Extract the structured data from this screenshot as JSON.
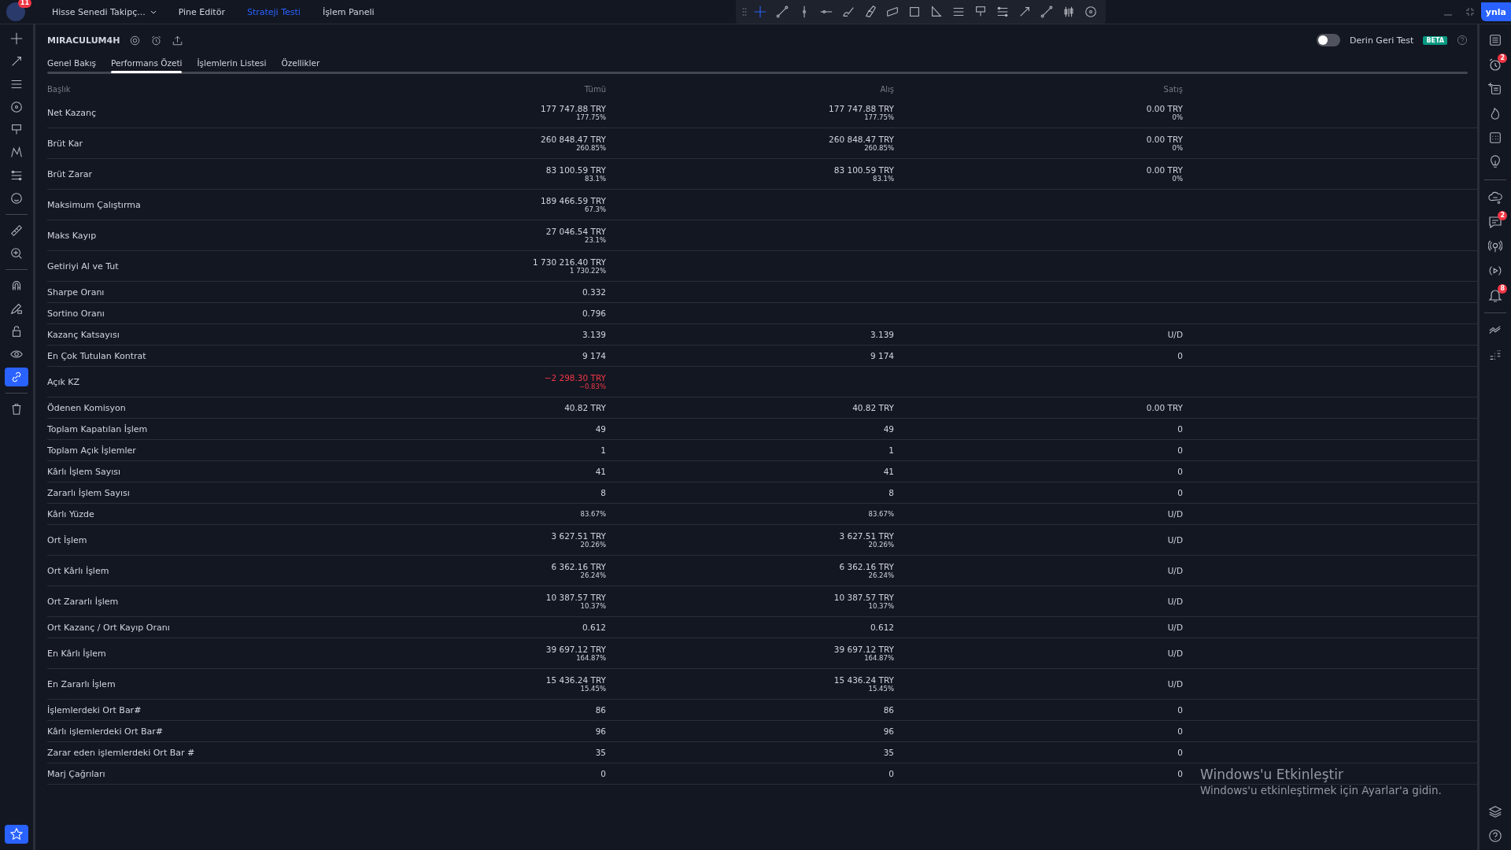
{
  "topbar": {
    "logo_badge": "11",
    "menu": [
      {
        "label": "Hisse Senedi Takipç...",
        "dropdown": true,
        "selected": false
      },
      {
        "label": "Pine Editör",
        "dropdown": false,
        "selected": false
      },
      {
        "label": "Strateji Testi",
        "dropdown": false,
        "selected": true
      },
      {
        "label": "İşlem Paneli",
        "dropdown": false,
        "selected": false
      }
    ],
    "drawing_tools": [
      {
        "kind": "cross",
        "selected": true
      },
      {
        "kind": "trend",
        "selected": false
      },
      {
        "kind": "vline",
        "selected": false
      },
      {
        "kind": "hline",
        "selected": false
      },
      {
        "kind": "brush",
        "selected": false
      },
      {
        "kind": "highlighter",
        "selected": false
      },
      {
        "kind": "parallel",
        "selected": false
      },
      {
        "kind": "rect",
        "selected": false
      },
      {
        "kind": "triangle",
        "selected": false
      },
      {
        "kind": "lines",
        "selected": false
      },
      {
        "kind": "flag",
        "selected": false
      },
      {
        "kind": "fib",
        "selected": false
      },
      {
        "kind": "arrow",
        "selected": false
      },
      {
        "kind": "trend",
        "selected": false
      },
      {
        "kind": "candles",
        "selected": false
      },
      {
        "kind": "circle",
        "selected": false
      }
    ],
    "publish_button": "ynla"
  },
  "left_toolbar": [
    {
      "kind": "cross",
      "selected": false
    },
    {
      "kind": "arrow",
      "selected": false
    },
    {
      "kind": "lines",
      "selected": false
    },
    {
      "kind": "circle",
      "selected": false
    },
    {
      "kind": "flag",
      "selected": false
    },
    {
      "kind": "pattern",
      "selected": false
    },
    {
      "kind": "fib",
      "selected": false
    },
    {
      "kind": "smile",
      "selected": false
    },
    {
      "kind": "ruler",
      "selected": false
    },
    {
      "kind": "zoom",
      "selected": false
    },
    {
      "kind": "magnet",
      "selected": false
    },
    {
      "kind": "pencil",
      "selected": false
    },
    {
      "kind": "lock",
      "selected": false
    },
    {
      "kind": "eye",
      "selected": false
    },
    {
      "kind": "link",
      "selected": true
    },
    {
      "kind": "trash",
      "selected": false
    }
  ],
  "left_bottom": {
    "kind": "star",
    "selected": true
  },
  "right_toolbar": [
    {
      "kind": "list"
    },
    {
      "kind": "alarm",
      "badge": "2"
    },
    {
      "kind": "addlist"
    },
    {
      "kind": "fire"
    },
    {
      "kind": "calendar"
    },
    {
      "kind": "bulb"
    },
    {
      "kind": "cloud"
    },
    {
      "kind": "chat",
      "badge": "2"
    },
    {
      "kind": "broadcast"
    },
    {
      "kind": "play"
    },
    {
      "kind": "bell",
      "badge": "8"
    },
    {
      "kind": "wave"
    },
    {
      "kind": "dots"
    }
  ],
  "right_bottom": [
    {
      "kind": "layers"
    },
    {
      "kind": "help"
    }
  ],
  "strategy": {
    "name": "MIRACULUM4H",
    "deep_backtest": {
      "label": "Derin Geri Test",
      "on": false,
      "badge": "BETA"
    }
  },
  "tabs": [
    {
      "label": "Genel Bakış",
      "selected": false
    },
    {
      "label": "Performans Özeti",
      "selected": true
    },
    {
      "label": "İşlemlerin Listesi",
      "selected": false
    },
    {
      "label": "Özellikler",
      "selected": false
    }
  ],
  "table": {
    "columns": [
      "Başlık",
      "Tümü",
      "Alış",
      "Satış"
    ],
    "rows": [
      {
        "label": "Net Kazanç",
        "negative": false,
        "values": [
          {
            "value": "177 747.88 TRY",
            "sub": "177.75%"
          },
          {
            "value": "177 747.88 TRY",
            "sub": "177.75%"
          },
          {
            "value": "0.00 TRY",
            "sub": "0%"
          }
        ]
      },
      {
        "label": "Brüt Kar",
        "negative": false,
        "values": [
          {
            "value": "260 848.47 TRY",
            "sub": "260.85%"
          },
          {
            "value": "260 848.47 TRY",
            "sub": "260.85%"
          },
          {
            "value": "0.00 TRY",
            "sub": "0%"
          }
        ]
      },
      {
        "label": "Brüt Zarar",
        "negative": false,
        "values": [
          {
            "value": "83 100.59 TRY",
            "sub": "83.1%"
          },
          {
            "value": "83 100.59 TRY",
            "sub": "83.1%"
          },
          {
            "value": "0.00 TRY",
            "sub": "0%"
          }
        ]
      },
      {
        "label": "Maksimum Çalıştırma",
        "negative": false,
        "values": [
          {
            "value": "189 466.59 TRY",
            "sub": "67.3%"
          }
        ]
      },
      {
        "label": "Maks Kayıp",
        "negative": false,
        "values": [
          {
            "value": "27 046.54 TRY",
            "sub": "23.1%"
          }
        ]
      },
      {
        "label": "Getiriyi Al ve Tut",
        "negative": false,
        "values": [
          {
            "value": "1 730 216.40 TRY",
            "sub": "1 730.22%"
          }
        ]
      },
      {
        "label": "Sharpe Oranı",
        "negative": false,
        "values": [
          {
            "value": "0.332"
          }
        ]
      },
      {
        "label": "Sortino Oranı",
        "negative": false,
        "values": [
          {
            "value": "0.796"
          }
        ]
      },
      {
        "label": "Kazanç Katsayısı",
        "negative": false,
        "values": [
          {
            "value": "3.139"
          },
          {
            "value": "3.139"
          },
          {
            "value": "U/D"
          }
        ]
      },
      {
        "label": "En Çok Tutulan Kontrat",
        "negative": false,
        "values": [
          {
            "value": "9 174"
          },
          {
            "value": "9 174"
          },
          {
            "value": "0"
          }
        ]
      },
      {
        "label": "Açık KZ",
        "negative": true,
        "values": [
          {
            "value": "−2 298.30 TRY",
            "sub": "−0.83%"
          }
        ]
      },
      {
        "label": "Ödenen Komisyon",
        "negative": false,
        "values": [
          {
            "value": "40.82 TRY"
          },
          {
            "value": "40.82 TRY"
          },
          {
            "value": "0.00 TRY"
          }
        ]
      },
      {
        "label": "Toplam Kapatılan İşlem",
        "negative": false,
        "values": [
          {
            "value": "49"
          },
          {
            "value": "49"
          },
          {
            "value": "0"
          }
        ]
      },
      {
        "label": "Toplam Açık İşlemler",
        "negative": false,
        "values": [
          {
            "value": "1"
          },
          {
            "value": "1"
          },
          {
            "value": "0"
          }
        ]
      },
      {
        "label": "Kârlı İşlem Sayısı",
        "negative": false,
        "values": [
          {
            "value": "41"
          },
          {
            "value": "41"
          },
          {
            "value": "0"
          }
        ]
      },
      {
        "label": "Zararlı İşlem Sayısı",
        "negative": false,
        "values": [
          {
            "value": "8"
          },
          {
            "value": "8"
          },
          {
            "value": "0"
          }
        ]
      },
      {
        "label": "Kârlı Yüzde",
        "negative": false,
        "values": [
          {
            "sub": "83.67%"
          },
          {
            "sub": "83.67%"
          },
          {
            "value": "U/D"
          }
        ]
      },
      {
        "label": "Ort İşlem",
        "negative": false,
        "values": [
          {
            "value": "3 627.51 TRY",
            "sub": "20.26%"
          },
          {
            "value": "3 627.51 TRY",
            "sub": "20.26%"
          },
          {
            "value": "U/D"
          }
        ]
      },
      {
        "label": "Ort Kârlı İşlem",
        "negative": false,
        "values": [
          {
            "value": "6 362.16 TRY",
            "sub": "26.24%"
          },
          {
            "value": "6 362.16 TRY",
            "sub": "26.24%"
          },
          {
            "value": "U/D"
          }
        ]
      },
      {
        "label": "Ort Zararlı İşlem",
        "negative": false,
        "values": [
          {
            "value": "10 387.57 TRY",
            "sub": "10.37%"
          },
          {
            "value": "10 387.57 TRY",
            "sub": "10.37%"
          },
          {
            "value": "U/D"
          }
        ]
      },
      {
        "label": "Ort Kazanç / Ort Kayıp Oranı",
        "negative": false,
        "values": [
          {
            "value": "0.612"
          },
          {
            "value": "0.612"
          },
          {
            "value": "U/D"
          }
        ]
      },
      {
        "label": "En Kârlı İşlem",
        "negative": false,
        "values": [
          {
            "value": "39 697.12 TRY",
            "sub": "164.87%"
          },
          {
            "value": "39 697.12 TRY",
            "sub": "164.87%"
          },
          {
            "value": "U/D"
          }
        ]
      },
      {
        "label": "En Zararlı İşlem",
        "negative": false,
        "values": [
          {
            "value": "15 436.24 TRY",
            "sub": "15.45%"
          },
          {
            "value": "15 436.24 TRY",
            "sub": "15.45%"
          },
          {
            "value": "U/D"
          }
        ]
      },
      {
        "label": "İşlemlerdeki Ort Bar#",
        "negative": false,
        "values": [
          {
            "value": "86"
          },
          {
            "value": "86"
          },
          {
            "value": "0"
          }
        ]
      },
      {
        "label": "Kârlı işlemlerdeki Ort Bar#",
        "negative": false,
        "values": [
          {
            "value": "96"
          },
          {
            "value": "96"
          },
          {
            "value": "0"
          }
        ]
      },
      {
        "label": "Zarar eden işlemlerdeki Ort Bar #",
        "negative": false,
        "values": [
          {
            "value": "35"
          },
          {
            "value": "35"
          },
          {
            "value": "0"
          }
        ]
      },
      {
        "label": "Marj Çağrıları",
        "negative": false,
        "values": [
          {
            "value": "0"
          },
          {
            "value": "0"
          },
          {
            "value": "0"
          }
        ]
      }
    ]
  },
  "os_notice": {
    "title": "Windows'u Etkinleştir",
    "text": "Windows'u etkinleştirmek için Ayarlar'a gidin."
  }
}
